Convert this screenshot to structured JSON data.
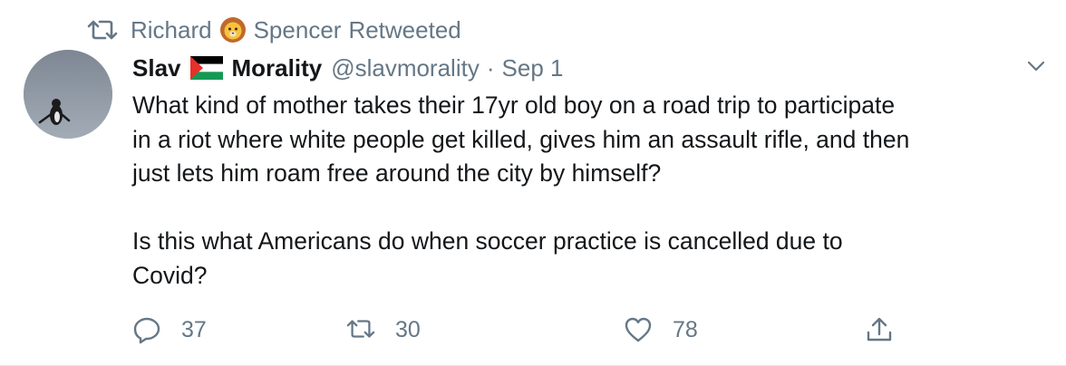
{
  "retweet_context": {
    "name_part1": "Richard",
    "name_part2": "Spencer",
    "suffix": "Retweeted",
    "icon": "retweet-icon",
    "emoji": "lion-face-emoji"
  },
  "tweet": {
    "author": {
      "name_part1": "Slav",
      "flag_icon": "palestine-flag-emoji",
      "name_part2": "Morality",
      "handle": "@slavmorality",
      "separator": "·",
      "date": "Sep 1",
      "avatar": "penguin-avatar"
    },
    "text_lines": [
      "What kind of mother takes their 17yr old boy on a road trip to participate",
      "in a riot where white people get killed, gives him an assault rifle, and then",
      "just lets him roam free around the city by himself?",
      "Is this what Americans do when soccer practice is cancelled due to",
      "Covid?"
    ],
    "actions": {
      "reply_count": "37",
      "retweet_count": "30",
      "like_count": "78"
    }
  },
  "colors": {
    "text": "#14171a",
    "secondary": "#657786"
  }
}
